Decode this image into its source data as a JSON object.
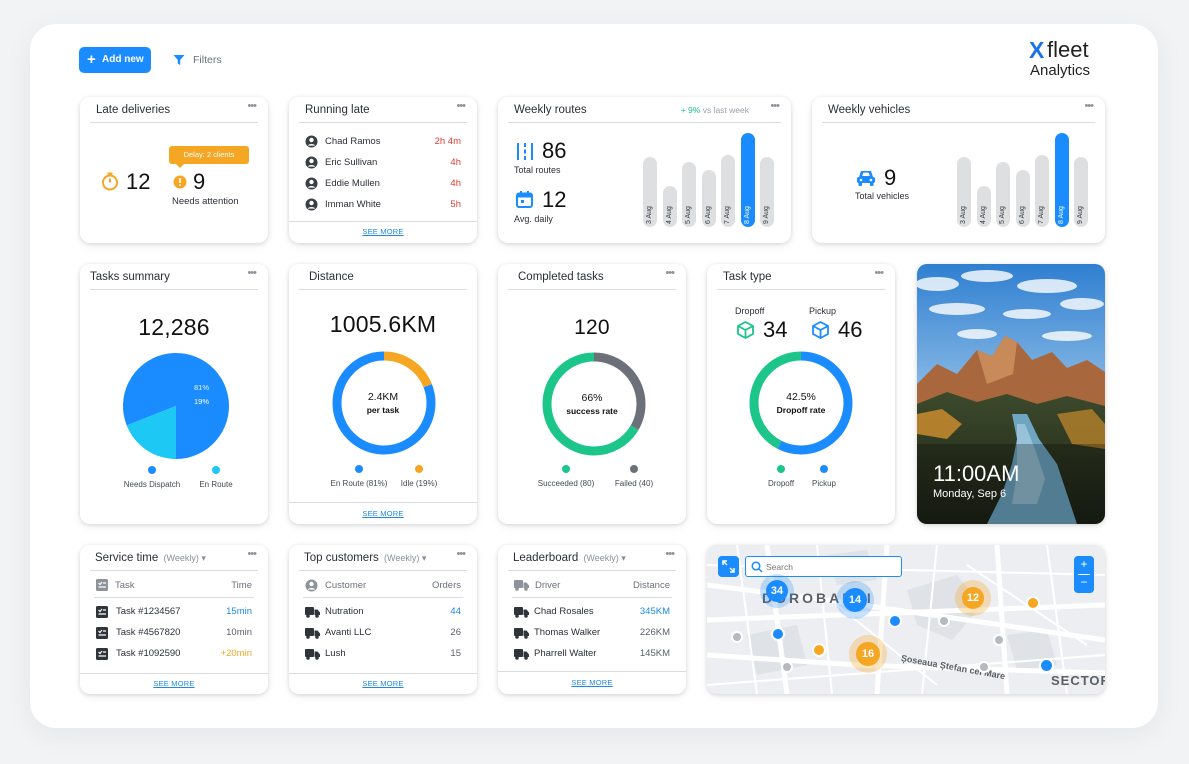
{
  "header": {
    "add_new": "Add new",
    "filters": "Filters",
    "brand_x": "X",
    "brand_fleet": "fleet",
    "brand_analytics": "Analytics"
  },
  "late_deliveries": {
    "title": "Late deliveries",
    "count": "12",
    "tooltip": "Delay: 2 clients",
    "attention_count": "9",
    "attention_label": "Needs attention"
  },
  "running_late": {
    "title": "Running late",
    "rows": [
      {
        "name": "Chad Ramos",
        "time": "2h 4m"
      },
      {
        "name": "Eric Sullivan",
        "time": "4h"
      },
      {
        "name": "Eddie Mullen",
        "time": "4h"
      },
      {
        "name": "Imman White",
        "time": "5h"
      }
    ],
    "see_more": "SEE MORE"
  },
  "weekly_routes": {
    "title": "Weekly routes",
    "change": "+ 9%",
    "change_suffix": "vs last week",
    "total": "86",
    "total_label": "Total routes",
    "avg": "12",
    "avg_label": "Avg. daily",
    "bars": [
      {
        "label": "3 Aug",
        "value": 0.74,
        "active": false
      },
      {
        "label": "4 Aug",
        "value": 0.44,
        "active": false
      },
      {
        "label": "5 Aug",
        "value": 0.69,
        "active": false
      },
      {
        "label": "6 Aug",
        "value": 0.61,
        "active": false
      },
      {
        "label": "7 Aug",
        "value": 0.77,
        "active": false
      },
      {
        "label": "8 Aug",
        "value": 1.0,
        "active": true
      },
      {
        "label": "9 Aug",
        "value": 0.74,
        "active": false
      }
    ]
  },
  "weekly_vehicles": {
    "title": "Weekly vehicles",
    "total": "9",
    "total_label": "Total vehicles",
    "bars": [
      {
        "label": "3 Aug",
        "value": 0.74,
        "active": false
      },
      {
        "label": "4 Aug",
        "value": 0.44,
        "active": false
      },
      {
        "label": "5 Aug",
        "value": 0.69,
        "active": false
      },
      {
        "label": "6 Aug",
        "value": 0.61,
        "active": false
      },
      {
        "label": "7 Aug",
        "value": 0.77,
        "active": false
      },
      {
        "label": "8 Aug",
        "value": 1.0,
        "active": true
      },
      {
        "label": "9 Aug",
        "value": 0.74,
        "active": false
      }
    ]
  },
  "tasks_summary": {
    "title": "Tasks summary",
    "total": "12,286",
    "slices": [
      {
        "name": "Needs Dispatch",
        "pct": "81%",
        "value": 81,
        "color": "#1a8cff"
      },
      {
        "name": "En Route",
        "pct": "19%",
        "value": 19,
        "color": "#1ec8f5"
      }
    ]
  },
  "distance": {
    "title": "Distance",
    "total": "1005.6KM",
    "center_value": "2.4KM",
    "center_label": "per task",
    "segments": [
      {
        "name": "En Route (81%)",
        "value": 81,
        "color": "#1a8cff"
      },
      {
        "name": "Idle (19%)",
        "value": 19,
        "color": "#f5a623"
      }
    ],
    "see_more": "SEE MORE"
  },
  "completed_tasks": {
    "title": "Completed tasks",
    "total": "120",
    "center_value": "66%",
    "center_label": "success rate",
    "segments": [
      {
        "name": "Succeeded (80)",
        "value": 80,
        "color": "#1cc58a"
      },
      {
        "name": "Failed (40)",
        "value": 40,
        "color": "#6b7079"
      }
    ]
  },
  "task_type": {
    "title": "Task type",
    "dropoff_label": "Dropoff",
    "dropoff_value": "34",
    "pickup_label": "Pickup",
    "pickup_value": "46",
    "center_value": "42.5%",
    "center_label": "Dropoff rate",
    "segments": [
      {
        "name": "Dropoff",
        "value": 42.5,
        "color": "#1cc58a"
      },
      {
        "name": "Pickup",
        "value": 57.5,
        "color": "#1a8cff"
      }
    ]
  },
  "clock": {
    "time": "11:00AM",
    "date": "Monday, Sep 6"
  },
  "service_time": {
    "title": "Service time",
    "period": "(Weekly)",
    "col_task": "Task",
    "col_time": "Time",
    "rows": [
      {
        "task": "Task #1234567",
        "time": "15min",
        "tone": "blue"
      },
      {
        "task": "Task #4567820",
        "time": "10min",
        "tone": "muted"
      },
      {
        "task": "Task #1092590",
        "time": "+20min",
        "tone": "orange"
      }
    ],
    "see_more": "SEE MORE"
  },
  "top_customers": {
    "title": "Top customers",
    "period": "(Weekly)",
    "col_customer": "Customer",
    "col_orders": "Orders",
    "rows": [
      {
        "name": "Nutration",
        "orders": "44",
        "tone": "blue"
      },
      {
        "name": "Avanti LLC",
        "orders": "26",
        "tone": "muted"
      },
      {
        "name": "Lush",
        "orders": "15",
        "tone": "muted"
      }
    ],
    "see_more": "SEE MORE"
  },
  "leaderboard": {
    "title": "Leaderboard",
    "period": "(Weekly)",
    "col_driver": "Driver",
    "col_distance": "Distance",
    "rows": [
      {
        "name": "Chad Rosales",
        "distance": "345KM",
        "tone": "blue"
      },
      {
        "name": "Thomas Walker",
        "distance": "226KM",
        "tone": "muted"
      },
      {
        "name": "Pharrell Walter",
        "distance": "145KM",
        "tone": "muted"
      }
    ],
    "see_more": "SEE MORE"
  },
  "map": {
    "search_placeholder": "Search",
    "zoom_in": "+",
    "zoom_out": "−",
    "label_district": "DOROBANȚI",
    "label_road": "Șoseaua Ștefan cel Mare",
    "label_sector": "SECTOR",
    "clusters": [
      "34",
      "14",
      "12",
      "16"
    ]
  }
}
